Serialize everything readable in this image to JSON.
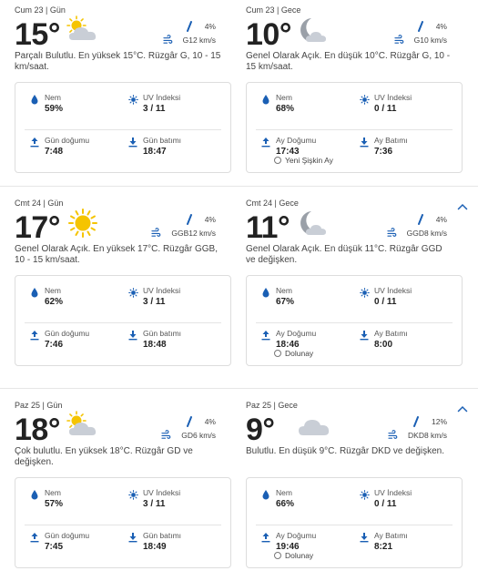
{
  "days": [
    {
      "day": {
        "header": "Cum 23 | Gün",
        "temp": "15°",
        "icon": "partly-cloudy-icon",
        "rain": "4%",
        "wind": "G12 km/s",
        "desc": "Parçalı Bulutlu. En yüksek 15°C. Rüzgâr G, 10 - 15 km/saat.",
        "humidity_label": "Nem",
        "humidity": "59%",
        "uv_label": "UV İndeksi",
        "uv": "3 / 11",
        "rise_label": "Gün doğumu",
        "rise": "7:48",
        "set_label": "Gün batımı",
        "set": "18:47"
      },
      "night": {
        "header": "Cum 23 | Gece",
        "temp": "10°",
        "icon": "moon-cloud-icon",
        "rain": "4%",
        "wind": "G10 km/s",
        "desc": "Genel Olarak Açık. En düşük 10°C. Rüzgâr G, 10 - 15 km/saat.",
        "humidity_label": "Nem",
        "humidity": "68%",
        "uv_label": "UV İndeksi",
        "uv": "0 / 11",
        "rise_label": "Ay Doğumu",
        "rise": "17:43",
        "set_label": "Ay Batımı",
        "set": "7:36",
        "phase": "Yeni Şişkin Ay"
      }
    },
    {
      "day": {
        "header": "Cmt 24 | Gün",
        "temp": "17°",
        "icon": "sun-icon",
        "rain": "4%",
        "wind": "GGB12 km/s",
        "desc": "Genel Olarak Açık. En yüksek 17°C. Rüzgâr GGB, 10 - 15 km/saat.",
        "humidity_label": "Nem",
        "humidity": "62%",
        "uv_label": "UV İndeksi",
        "uv": "3 / 11",
        "rise_label": "Gün doğumu",
        "rise": "7:46",
        "set_label": "Gün batımı",
        "set": "18:48"
      },
      "night": {
        "header": "Cmt 24 | Gece",
        "temp": "11°",
        "icon": "moon-cloud-icon",
        "rain": "4%",
        "wind": "GGD8 km/s",
        "desc": "Genel Olarak Açık. En düşük 11°C. Rüzgâr GGD ve değişken.",
        "humidity_label": "Nem",
        "humidity": "67%",
        "uv_label": "UV İndeksi",
        "uv": "0 / 11",
        "rise_label": "Ay Doğumu",
        "rise": "18:46",
        "set_label": "Ay Batımı",
        "set": "8:00",
        "phase": "Dolunay"
      }
    },
    {
      "day": {
        "header": "Paz 25 | Gün",
        "temp": "18°",
        "icon": "partly-cloudy-icon",
        "rain": "4%",
        "wind": "GD6 km/s",
        "desc": "Çok bulutlu. En yüksek 18°C. Rüzgâr GD ve değişken.",
        "humidity_label": "Nem",
        "humidity": "57%",
        "uv_label": "UV İndeksi",
        "uv": "3 / 11",
        "rise_label": "Gün doğumu",
        "rise": "7:45",
        "set_label": "Gün batımı",
        "set": "18:49"
      },
      "night": {
        "header": "Paz 25 | Gece",
        "temp": "9°",
        "icon": "cloud-icon",
        "rain": "12%",
        "wind": "DKD8 km/s",
        "desc": "Bulutlu. En düşük 9°C. Rüzgâr DKD ve değişken.",
        "humidity_label": "Nem",
        "humidity": "66%",
        "uv_label": "UV İndeksi",
        "uv": "0 / 11",
        "rise_label": "Ay Doğumu",
        "rise": "19:46",
        "set_label": "Ay Batımı",
        "set": "8:21",
        "phase": "Dolunay"
      }
    }
  ],
  "colors": {
    "accent": "#1a5fb4",
    "sun": "#f5c400",
    "cloud": "#c9ced6",
    "moon": "#9aa0a8"
  }
}
